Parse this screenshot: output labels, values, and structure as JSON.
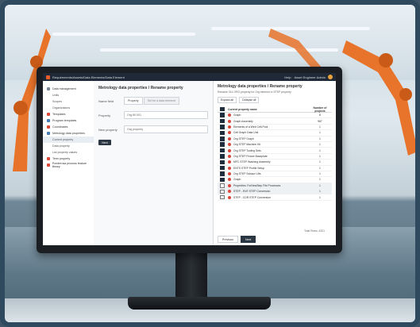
{
  "app": {
    "title": "Requirements/Assets/Data Elements/Data Element",
    "user_label": "Asset Engineer Admin",
    "user_menu_label": "Help"
  },
  "nav": {
    "items": [
      {
        "label": "Data management",
        "level": 0,
        "icon": "g"
      },
      {
        "label": "Units",
        "level": 1
      },
      {
        "label": "Scopes",
        "level": 1
      },
      {
        "label": "Organizations",
        "level": 1
      },
      {
        "label": "Templates",
        "level": 0,
        "icon": "r"
      },
      {
        "label": "Program templates",
        "level": 0,
        "icon": "b"
      },
      {
        "label": "Coordinates",
        "level": 0,
        "icon": "r"
      },
      {
        "label": "Metrology data properties",
        "level": 0,
        "icon": "b"
      },
      {
        "label": "Current property",
        "level": 1,
        "active": true
      },
      {
        "label": "Data property",
        "level": 1
      },
      {
        "label": "List property values",
        "level": 1
      },
      {
        "label": "Term property",
        "level": 0,
        "icon": "r"
      },
      {
        "label": "Ponderosa process feature library",
        "level": 0,
        "icon": "r"
      }
    ]
  },
  "middle": {
    "title": "Metrology data properties / Rename property",
    "fields": [
      {
        "label": "Name field",
        "tabs": [
          "Property",
          "Set for a data element"
        ]
      },
      {
        "label": "Property",
        "value": "Org 80 001"
      },
      {
        "label": "New property",
        "value": "Org property"
      }
    ],
    "button_label": "Next"
  },
  "right": {
    "title": "Metrology data properties / Rename property",
    "subtitle": "Rename 314 ORG property for Org element in STEP property",
    "actions": [
      "Expand all",
      "Collapse all"
    ],
    "columns": [
      "Current property name",
      "Number of projects"
    ],
    "rows": [
      {
        "name": "Graph",
        "count": "8",
        "checked": true
      },
      {
        "name": "Graph Assembly",
        "count": "987",
        "checked": true
      },
      {
        "name": "Elements of a Web Cell-Pool",
        "count": "1",
        "checked": true
      },
      {
        "name": "Cell Graph Data Unit",
        "count": "1",
        "checked": true
      },
      {
        "name": "Org STEP Graph",
        "count": "1",
        "checked": true
      },
      {
        "name": "Org STEP Machine Kit",
        "count": "1",
        "checked": true
      },
      {
        "name": "Org STEP Tooling Sets",
        "count": "1",
        "checked": true
      },
      {
        "name": "Org STEP Fixture Baseplate",
        "count": "1",
        "checked": true
      },
      {
        "name": "MFC STEP Washing Assembly",
        "count": "1",
        "checked": true
      },
      {
        "name": "ENTS STEP Profile Setup",
        "count": "1",
        "checked": true
      },
      {
        "name": "Org STEP Scissor Lifts",
        "count": "1",
        "checked": true
      },
      {
        "name": "Graph",
        "count": "1",
        "checked": true
      },
      {
        "name": "Properties: ForNewStep File Processes",
        "count": "1",
        "checked": false,
        "selected": true
      },
      {
        "name": "STEP - ENT STEP Conversion",
        "count": "1",
        "checked": false,
        "selected": true
      },
      {
        "name": "STEP - CDR STEP Conversion",
        "count": "1",
        "checked": false
      }
    ],
    "footer_text": "Total Rows: 4321",
    "buttons": [
      "Previous",
      "Next"
    ]
  }
}
